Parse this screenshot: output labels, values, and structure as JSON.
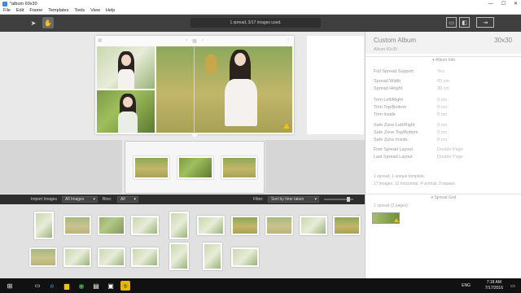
{
  "window": {
    "title": "*album 60x30",
    "controls": [
      "—",
      "☐",
      "✕"
    ]
  },
  "menu": [
    "File",
    "Edit",
    "Frame",
    "Templates",
    "Tools",
    "View",
    "Help"
  ],
  "toolbar": {
    "status": "1 spread, 3/17 images used.",
    "tools": [
      "arrow-select-icon",
      "hand-pan-icon"
    ],
    "right_tools": [
      "single-page-view-icon",
      "spread-view-icon",
      "export-icon"
    ]
  },
  "spread_nav": {
    "prev": "‹",
    "mid": "▦",
    "next": "›",
    "menu": "⋮"
  },
  "album": {
    "name": "Custom Album",
    "size": "30x30",
    "subtitle": "Album 60x30",
    "section_info": "Album Info",
    "rows": [
      {
        "k": "Full Spread Support",
        "v": "Yes"
      },
      {
        "k": "Spread Width",
        "v": "60 cm"
      },
      {
        "k": "Spread Height",
        "v": "30 cm"
      },
      {
        "k": "Trim Left/Right",
        "v": "0 cm"
      },
      {
        "k": "Trim Top/Bottom",
        "v": "0 cm"
      },
      {
        "k": "Trim Inside",
        "v": "0 cm"
      },
      {
        "k": "Safe Zone Left/Right",
        "v": "0 cm"
      },
      {
        "k": "Safe Zone Top/Bottom",
        "v": "0 cm"
      },
      {
        "k": "Safe Zone Inside",
        "v": "0 cm"
      },
      {
        "k": "First Spread Layout",
        "v": "Double Page"
      },
      {
        "k": "Last Spread Layout",
        "v": "Double Page"
      }
    ],
    "note_line1": "1 spread. 1 unique template.",
    "note_line2": "17 images. 12 horizontal. 4 vertical. 0 square.",
    "section_grid": "Spread Grid",
    "grid_note": "1 spread (2 pages)"
  },
  "import_bar": {
    "label": "Import Images",
    "images_select": "All Images",
    "bins_label": "Bins:",
    "bins_select": "All",
    "filter_label": "Filter:",
    "sort_select": "Sort by time taken"
  },
  "taskbar": {
    "lang": "ENG",
    "time": "7:18 AM",
    "date": "7/17/2016",
    "icons": [
      "windows-start-icon",
      "task-view-icon",
      "file-explorer-icon",
      "store-icon",
      "chrome-icon",
      "app-icon",
      "app-icon-2",
      "album-app-icon"
    ]
  }
}
